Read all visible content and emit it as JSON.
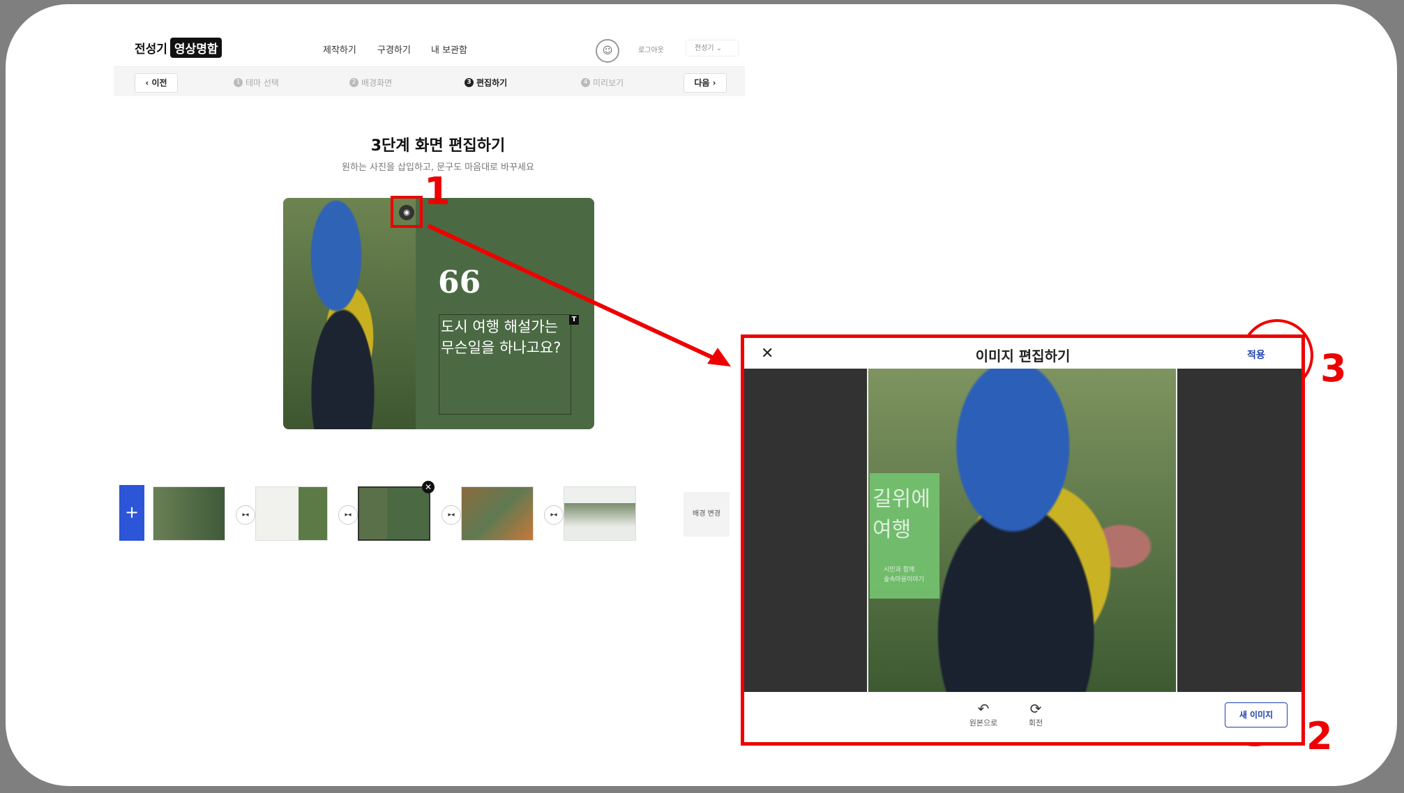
{
  "app": {
    "logo_left": "전성기",
    "logo_badge": "영상명함",
    "nav": [
      "제작하기",
      "구경하기",
      "내 보관함"
    ],
    "avatar_glyph": "☺",
    "logout": "로그아웃",
    "user_menu": "전성기 ⌄"
  },
  "steps": {
    "prev": "‹ 이전",
    "next": "다음 ›",
    "items": [
      {
        "num": "1",
        "label": "테마 선택"
      },
      {
        "num": "2",
        "label": "배경화면"
      },
      {
        "num": "3",
        "label": "편집하기"
      },
      {
        "num": "4",
        "label": "미리보기"
      }
    ],
    "active_index": 2
  },
  "editor": {
    "title": "3단계 화면 편집하기",
    "subtitle": "원하는 사진을 삽입하고, 문구도 마음대로 바꾸세요",
    "quote_mark": "66",
    "slide_text": "도시 여행 해설가는 무슨일을 하나고요?",
    "text_badge": "T",
    "camera_glyph": "◉"
  },
  "thumbnails": {
    "add": "+",
    "transition_glyph": "▸◂",
    "remove_glyph": "✕",
    "bg_change": "배경 변경"
  },
  "modal": {
    "close": "✕",
    "title": "이미지 편집하기",
    "apply": "적용",
    "flag_text": "길위에 여행",
    "flag_sub": "시민과 함께\n숲속마을이야기",
    "tools": [
      {
        "icon": "↶",
        "label": "원본으로"
      },
      {
        "icon": "⟳",
        "label": "회전"
      }
    ],
    "new_image": "새 이미지"
  },
  "annotations": [
    "1",
    "2",
    "3"
  ],
  "colors": {
    "accent_red": "#e00000",
    "brand_blue": "#2d55d8",
    "slide_green": "#4b6a44",
    "apply_blue": "#1f3fb0"
  }
}
